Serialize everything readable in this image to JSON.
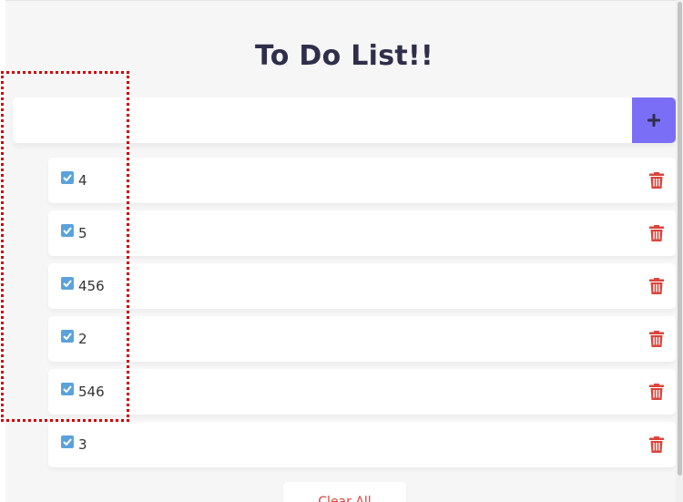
{
  "app": {
    "title": "To Do List!!"
  },
  "input": {
    "value": "",
    "placeholder": "",
    "add_icon": "plus-icon"
  },
  "colors": {
    "accent": "#7b6ef6",
    "check": "#5aa2dc",
    "danger": "#d9443c",
    "title": "#2f2f4b"
  },
  "todos": [
    {
      "text": "4",
      "checked": true
    },
    {
      "text": "5",
      "checked": true
    },
    {
      "text": "456",
      "checked": true
    },
    {
      "text": "2",
      "checked": true
    },
    {
      "text": "546",
      "checked": true
    },
    {
      "text": "3",
      "checked": true
    }
  ],
  "footer": {
    "clear_label": "Clear All"
  }
}
